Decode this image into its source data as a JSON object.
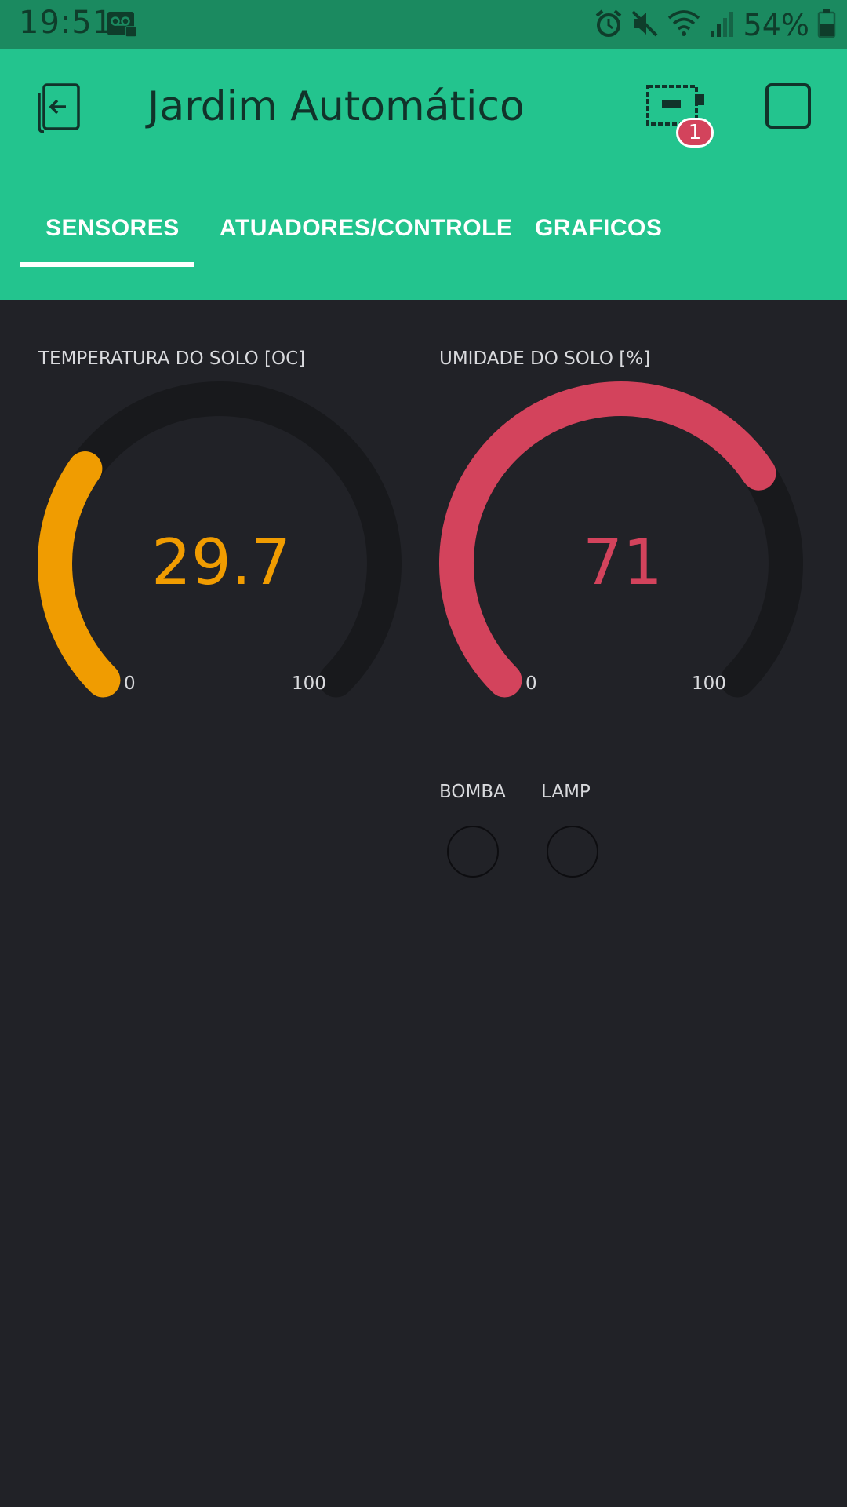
{
  "status_bar": {
    "time": "19:51",
    "battery": "54%",
    "icons": [
      "voicemail-icon",
      "alarm-icon",
      "mute-icon",
      "wifi-icon",
      "signal-icon",
      "battery-icon"
    ]
  },
  "app_bar": {
    "title": "Jardim Automático",
    "device_badge": "1",
    "icons": [
      "back-icon",
      "device-icon",
      "square-icon"
    ],
    "color": "#23c48e"
  },
  "tabs": [
    {
      "label": "SENSORES",
      "active": true
    },
    {
      "label": "ATUADORES/CONTROLE",
      "active": false
    },
    {
      "label": "GRAFICOS",
      "active": false
    }
  ],
  "gauges": [
    {
      "label": "TEMPERATURA DO SOLO [OC]",
      "value": "29.7",
      "min": "0",
      "max": "100",
      "fraction": 0.297,
      "color": "#f09c01"
    },
    {
      "label": "UMIDADE DO SOLO [%]",
      "value": "71",
      "min": "0",
      "max": "100",
      "fraction": 0.71,
      "color": "#d3435c"
    }
  ],
  "leds": [
    {
      "label": "BOMBA"
    },
    {
      "label": "LAMP"
    }
  ],
  "colors": {
    "background": "#212227",
    "track": "#18191c"
  }
}
